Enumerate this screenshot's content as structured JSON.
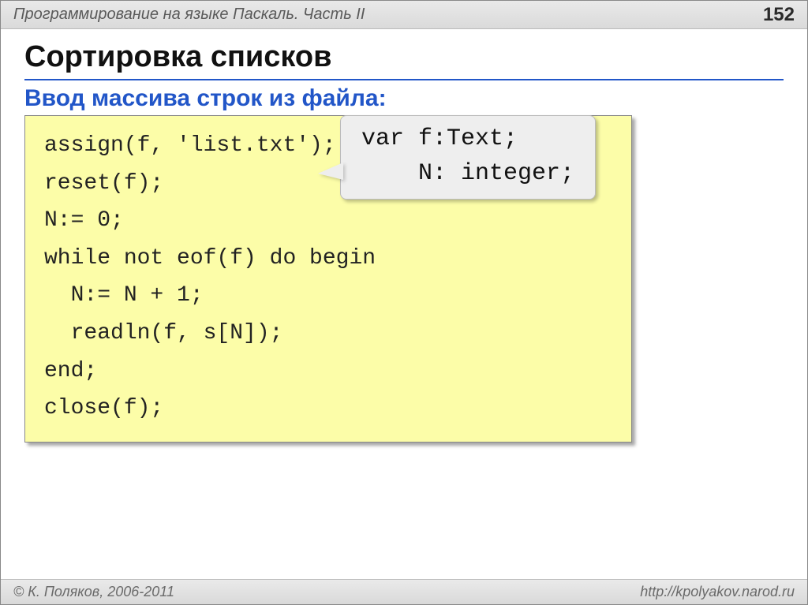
{
  "header": {
    "title": "Программирование на языке Паскаль. Часть II",
    "page": "152"
  },
  "main": {
    "heading": "Сортировка списков",
    "subheading": "Ввод массива строк из файла:"
  },
  "code": {
    "line1": "assign(f, 'list.txt');",
    "line2": "reset(f);",
    "line3": "N:= 0;",
    "line4": "while not eof(f) do begin",
    "line5": "  N:= N + 1;",
    "line6": "  readln(f, s[N]);",
    "line7": "end;",
    "line8": "close(f);"
  },
  "callout": {
    "line1": "var f:Text;",
    "line2": "    N: integer;"
  },
  "footer": {
    "copyright": "© К. Поляков, 2006-2011",
    "url": "http://kpolyakov.narod.ru"
  }
}
